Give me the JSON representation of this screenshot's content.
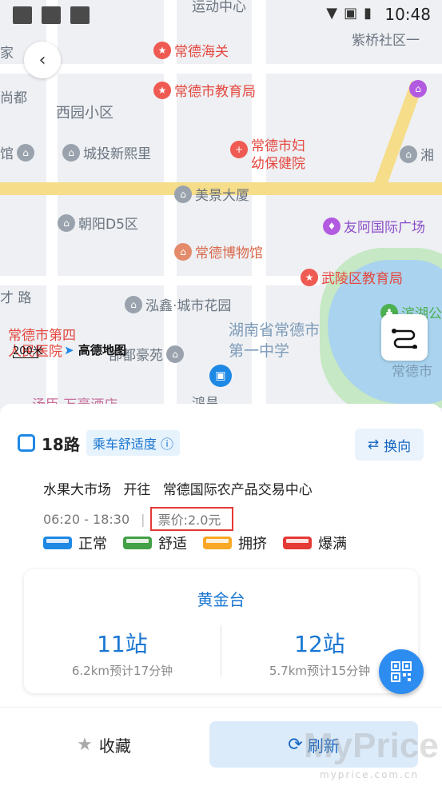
{
  "status_bar": {
    "time": "10:48"
  },
  "map": {
    "pois": {
      "top_center": "运动中心",
      "jia": "家",
      "haiguan": "常德海关",
      "ziqiao": "紫桥社区一",
      "shangdu": "尚都",
      "jiaoyuju": "常德市教育局",
      "xiyuan": "西园小区",
      "guan": "馆",
      "chengtou": "城投新熙里",
      "fuyou": "常德市妇幼保健院",
      "xiang": "湘",
      "meijing": "美景大厦",
      "chaoyang": "朝阳D5区",
      "youa": "友阿国际广场",
      "bowuguan": "常德博物馆",
      "wuling": "武陵区教育局",
      "cailu": "才 路",
      "hongxin": "泓鑫·城市花园",
      "hunan": "湖南省常德市第一中学",
      "changdesi": "常德市第四人民医院",
      "shaohuo": "部都豪苑",
      "binhu": "滨湖公",
      "changdeshi": "常德市",
      "tangchen": "汤臣·万豪酒店",
      "hongchang": "鸿昌"
    },
    "scale_label": "200米",
    "logo_label": "高德地图"
  },
  "line": {
    "name": "18路",
    "comfort_label": "乘车舒适度",
    "switch_label": "换向",
    "from": "水果大市场",
    "towards": "开往",
    "to": "常德国际农产品交易中心",
    "hours": "06:20 - 18:30",
    "price": "票价:2.0元"
  },
  "legend": [
    {
      "label": "正常",
      "color": "#1e88e5"
    },
    {
      "label": "舒适",
      "color": "#43a047"
    },
    {
      "label": "拥挤",
      "color": "#f9a825"
    },
    {
      "label": "爆满",
      "color": "#e53935"
    }
  ],
  "station": {
    "name": "黄金台",
    "left": {
      "count": "11站",
      "sub": "6.2km预计17分钟"
    },
    "right": {
      "count": "12站",
      "sub": "5.7km预计15分钟"
    }
  },
  "actions": {
    "favorite": "收藏",
    "refresh": "刷新"
  },
  "watermark": {
    "main": "MyPrice",
    "sub": "myprice.com.cn"
  }
}
